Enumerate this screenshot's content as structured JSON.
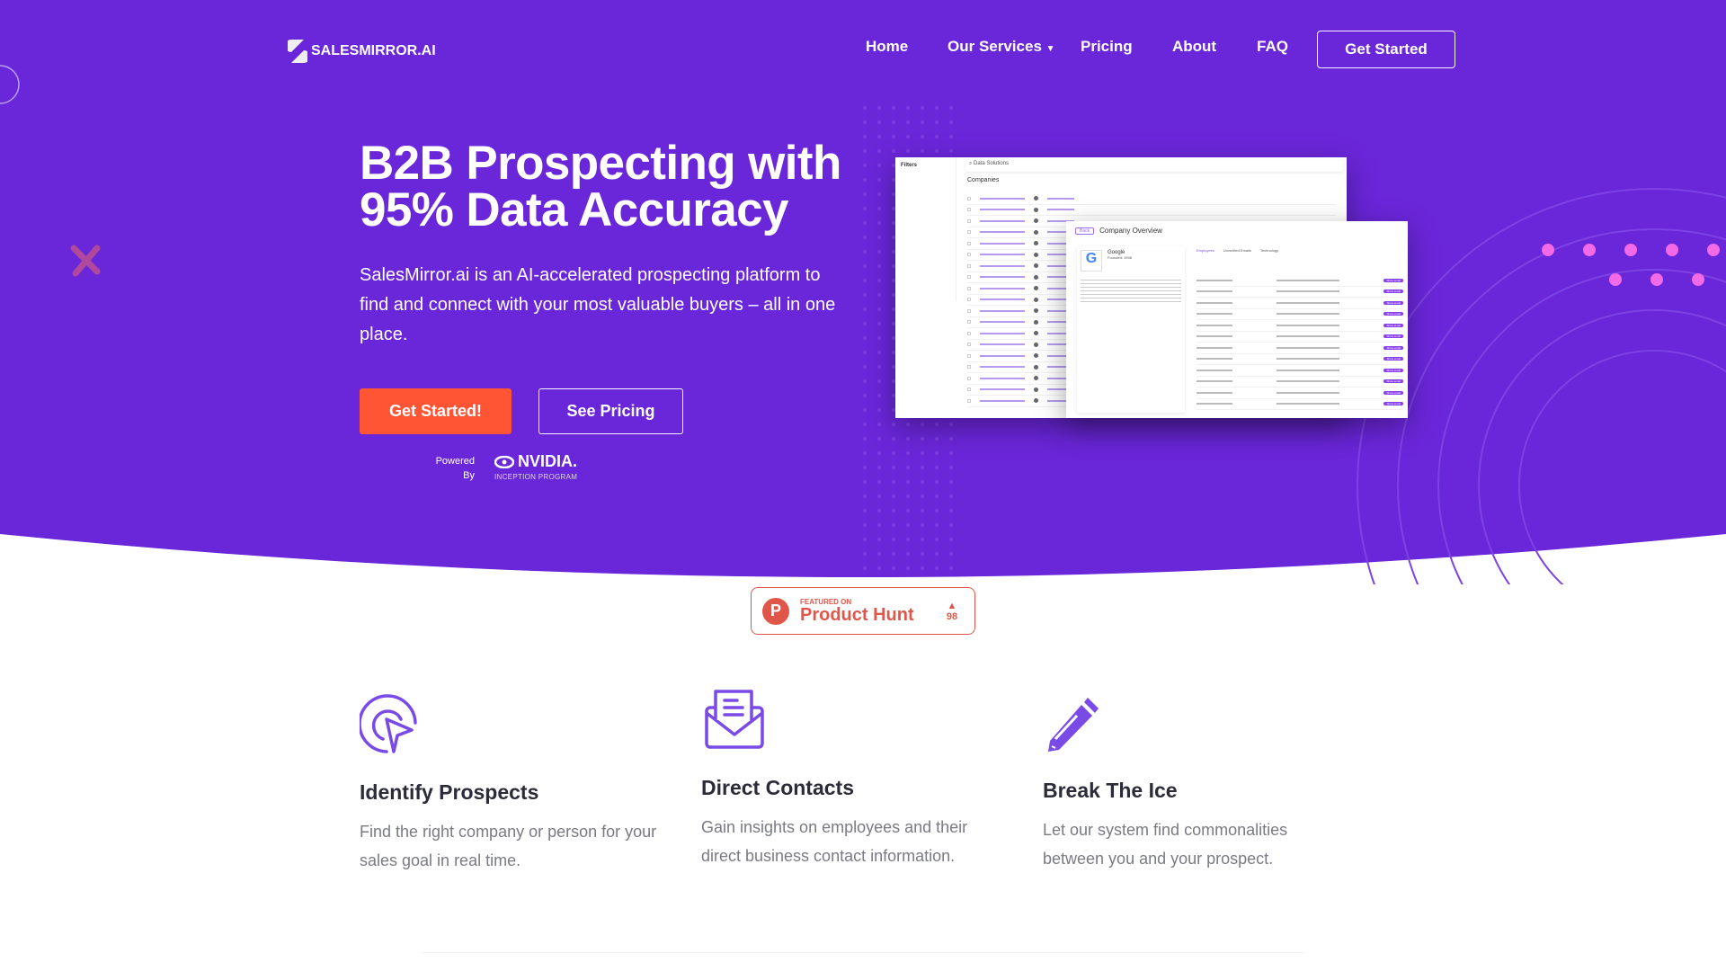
{
  "colors": {
    "brand_purple": "#6a26d9",
    "cta_orange": "#ff5535",
    "icon_purple": "#7a4ae6",
    "product_hunt": "#e0574a",
    "accent_pink": "#f26ae6"
  },
  "header": {
    "logo_text": "SALESMIRROR.AI",
    "nav": [
      {
        "label": "Home"
      },
      {
        "label": "Our Services",
        "has_dropdown": true
      },
      {
        "label": "Pricing"
      },
      {
        "label": "About"
      },
      {
        "label": "FAQ"
      }
    ],
    "cta_label": "Get Started"
  },
  "hero": {
    "title_line1": "B2B Prospecting with",
    "title_line2": "95% Data Accuracy",
    "description": "SalesMirror.ai is an AI-accelerated prospecting platform to find and connect with your most valuable buyers – all in one place.",
    "primary_button": "Get Started!",
    "secondary_button": "See Pricing",
    "powered_by": "Powered By",
    "partner_logo": "NVIDIA.",
    "partner_program": "INCEPTION PROGRAM"
  },
  "mockup": {
    "filters_label": "Filters",
    "search_value": "Data Solutions",
    "companies_label": "Companies",
    "overview_title": "Company Overview",
    "back_label": "Back",
    "company_name": "Google",
    "founded": "Founded: 1998",
    "tabs": [
      "Employees",
      "Unverified Emails",
      "Technology"
    ],
    "show_email_label": "Show email"
  },
  "product_hunt": {
    "featured": "FEATURED ON",
    "name": "Product Hunt",
    "votes": "98"
  },
  "features": [
    {
      "icon": "target-cursor-icon",
      "title": "Identify Prospects",
      "description": "Find the right company or person for your sales goal in real time."
    },
    {
      "icon": "envelope-letter-icon",
      "title": "Direct Contacts",
      "description": "Gain insights on employees and their direct business contact information."
    },
    {
      "icon": "pencil-icon",
      "title": "Break The Ice",
      "description": "Let our system find commonalities between you and your prospect."
    }
  ]
}
